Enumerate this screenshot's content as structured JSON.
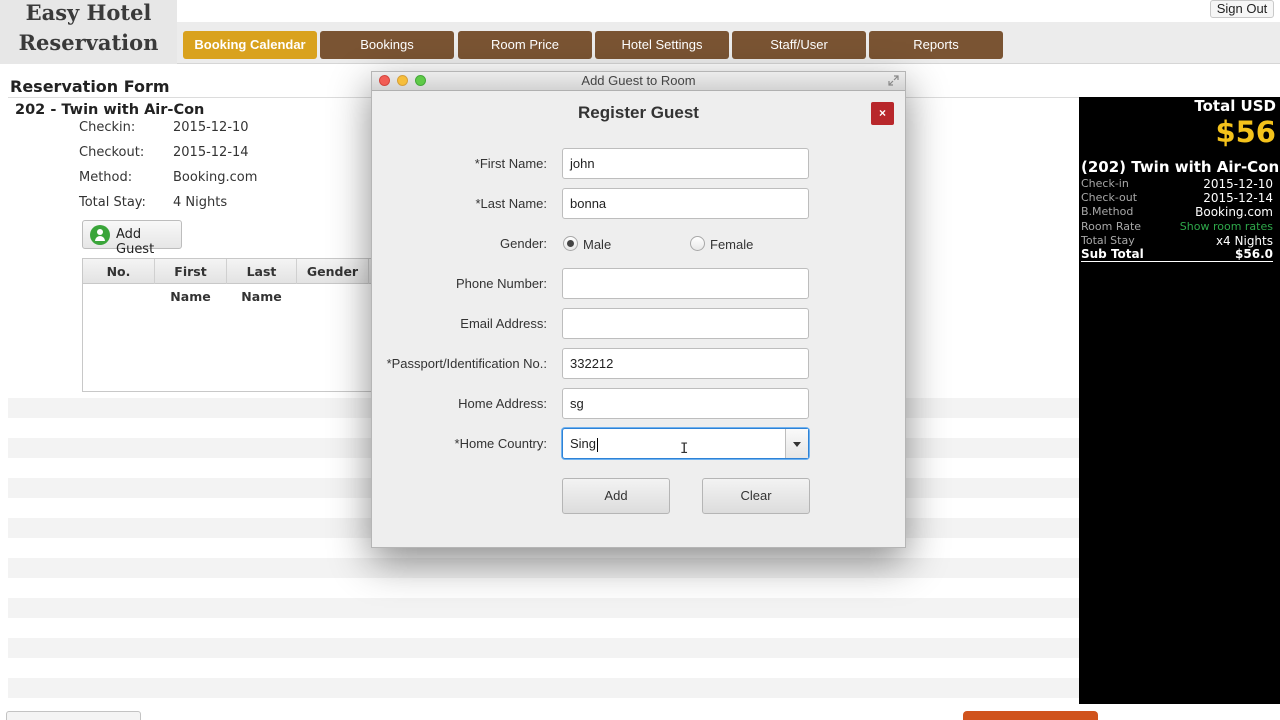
{
  "app": {
    "logo_line1": "Easy Hotel",
    "logo_line2": "Reservation",
    "sign_out": "Sign Out"
  },
  "nav": {
    "tabs": [
      {
        "label": "Booking Calendar",
        "active": true
      },
      {
        "label": "Bookings",
        "active": false
      },
      {
        "label": "Room Price",
        "active": false
      },
      {
        "label": "Hotel Settings",
        "active": false
      },
      {
        "label": "Staff/User",
        "active": false
      },
      {
        "label": "Reports",
        "active": false
      }
    ]
  },
  "reservation": {
    "title": "Reservation Form",
    "room": "202 - Twin with Air-Con",
    "fields": [
      {
        "label": "Checkin:",
        "value": "2015-12-10"
      },
      {
        "label": "Checkout:",
        "value": "2015-12-14"
      },
      {
        "label": "Method:",
        "value": "Booking.com"
      },
      {
        "label": "Total Stay:",
        "value": "4 Nights"
      }
    ],
    "add_guest_label": "Add Guest",
    "table_headers": [
      "No.",
      "First Name",
      "Last Name",
      "Gender"
    ]
  },
  "summary": {
    "total_label": "Total USD",
    "total_value": "$56",
    "room": "(202) Twin with Air-Con",
    "rows": [
      {
        "label": "Check-in",
        "value": "2015-12-10"
      },
      {
        "label": "Check-out",
        "value": "2015-12-14"
      },
      {
        "label": "B.Method",
        "value": "Booking.com"
      },
      {
        "label": "Room Rate",
        "value": "Show room rates"
      },
      {
        "label": "Total Stay",
        "value": "x4 Nights"
      }
    ],
    "subtotal_label": "Sub Total",
    "subtotal_value": "$56.0",
    "accent_color": "#f4c21b",
    "link_color": "#2ea84a"
  },
  "dialog": {
    "window_title": "Add Guest to Room",
    "title": "Register Guest",
    "close_label": "×",
    "first_name_label": "*First Name:",
    "first_name_value": "john",
    "last_name_label": "*Last Name:",
    "last_name_value": "bonna",
    "gender_label": "Gender:",
    "gender_male": "Male",
    "gender_female": "Female",
    "gender_selected": "Male",
    "phone_label": "Phone Number:",
    "phone_value": "",
    "email_label": "Email Address:",
    "email_value": "",
    "passport_label": "*Passport/Identification No.:",
    "passport_value": "332212",
    "address_label": "Home Address:",
    "address_value": "sg",
    "country_label": "*Home Country:",
    "country_value": "Sing",
    "add_button": "Add",
    "clear_button": "Clear"
  }
}
